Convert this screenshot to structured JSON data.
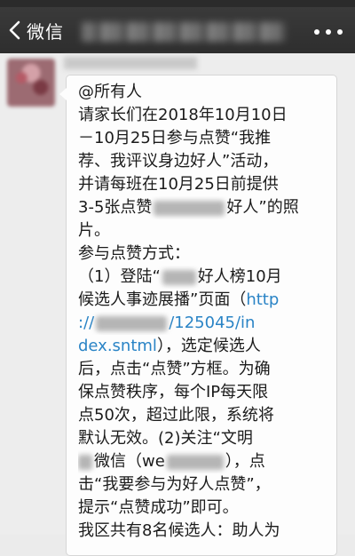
{
  "nav": {
    "back_label": "微信"
  },
  "message": {
    "lines": [
      "@所有人",
      "请家长们在2018年10月10日",
      "－10月25日参与点赞“我推",
      "荐、我评议身边好人”活动，",
      "并请每班在10月25日前提供",
      [
        "3-5张点赞",
        "好人”的照"
      ],
      "片。",
      "参与点赞方式：",
      [
        "（1）登陆“",
        "好人榜10月"
      ],
      [
        "候选人事迹展播”页面（",
        "http"
      ],
      [
        "://",
        "/125045/in"
      ],
      [
        "dex.sntml",
        "），选定候选人"
      ],
      "后，点击“点赞”方框。为确",
      "保点赞秩序，每个IP每天限",
      "点50次，超过此限，系统将",
      "默认无效。(2)关注“文明",
      [
        "微信（we",
        "），点"
      ],
      "击“我要参与为好人点赞”，",
      "提示“点赞成功”即可。",
      "我区共有8名候选人：助人为"
    ]
  }
}
